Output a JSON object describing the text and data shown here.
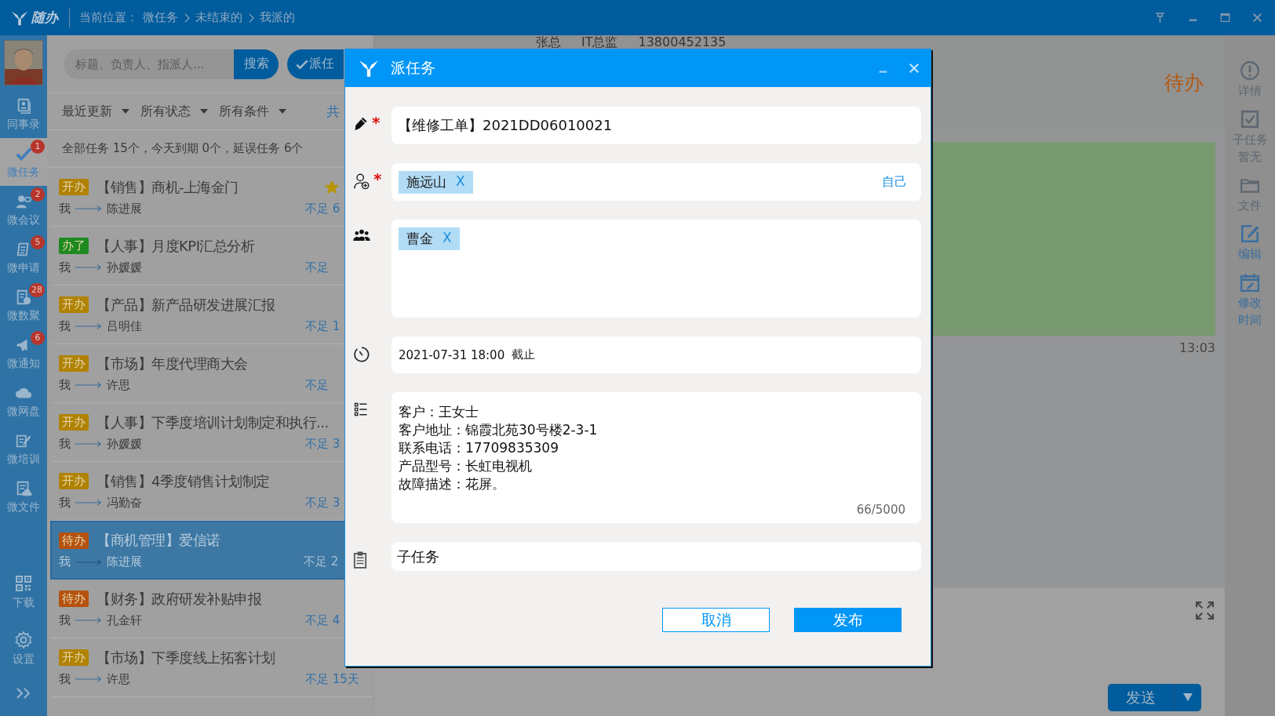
{
  "titlebar": {
    "logo_text": "随办",
    "location_label": "当前位置：",
    "breadcrumb": [
      "微任务",
      "未结束的",
      "我派的"
    ]
  },
  "sidebar": {
    "items": [
      {
        "label": "同事录",
        "selected": false
      },
      {
        "label": "微任务",
        "badge": "1",
        "selected": true
      },
      {
        "label": "微会议",
        "badge": "2",
        "selected": false
      },
      {
        "label": "微申请",
        "badge": "5",
        "selected": false
      },
      {
        "label": "微数聚",
        "badge": "28",
        "selected": false
      },
      {
        "label": "微通知",
        "badge": "6",
        "selected": false
      },
      {
        "label": "微网盘",
        "selected": false
      },
      {
        "label": "微培训",
        "selected": false
      },
      {
        "label": "微文件",
        "selected": false
      }
    ],
    "bottom_items": [
      {
        "label": "下载"
      },
      {
        "label": "设置"
      }
    ]
  },
  "list": {
    "search": {
      "placeholder": "标题、负责人、指派人...",
      "button": "搜索"
    },
    "assign_button": "派任",
    "filters": [
      {
        "label": "最近更新"
      },
      {
        "label": "所有状态"
      },
      {
        "label": "所有条件"
      }
    ],
    "filter_cut": "共",
    "summary": "全部任务 15个，今天到期 0个，延误任务 6个",
    "tasks": [
      {
        "status": "开办",
        "color": "#b08200",
        "title": "【销售】商机-上海金门",
        "from": "我",
        "to": "陈进展",
        "due": "不足 6",
        "starred": true,
        "selected": false
      },
      {
        "status": "办了",
        "color": "#1f8a1f",
        "title": "【人事】月度KPI汇总分析",
        "from": "我",
        "to": "孙媛媛",
        "due": "不足",
        "starred": false,
        "selected": false
      },
      {
        "status": "开办",
        "color": "#b08200",
        "title": "【产品】新产品研发进展汇报",
        "from": "我",
        "to": "吕明佳",
        "due": "不足 1",
        "starred": false,
        "selected": false
      },
      {
        "status": "开办",
        "color": "#b08200",
        "title": "【市场】年度代理商大会",
        "from": "我",
        "to": "许思",
        "due": "不足",
        "starred": false,
        "selected": false
      },
      {
        "status": "开办",
        "color": "#b08200",
        "title": "【人事】下季度培训计划制定和执行...",
        "from": "我",
        "to": "孙媛媛",
        "due": "不足 3",
        "starred": false,
        "selected": false
      },
      {
        "status": "开办",
        "color": "#b08200",
        "title": "【销售】4季度销售计划制定",
        "from": "我",
        "to": "冯勤奋",
        "due": "不足 3",
        "starred": false,
        "selected": false
      },
      {
        "status": "待办",
        "color": "#b5520e",
        "title": "【商机管理】爱信诺",
        "from": "我",
        "to": "陈进展",
        "due": "不足 2",
        "starred": false,
        "selected": true
      },
      {
        "status": "待办",
        "color": "#b5520e",
        "title": "【财务】政府研发补贴申报",
        "from": "我",
        "to": "孔金轩",
        "due": "不足 4",
        "starred": false,
        "selected": false
      },
      {
        "status": "开办",
        "color": "#b08200",
        "title": "【市场】下季度线上拓客计划",
        "from": "我",
        "to": "许思",
        "due": "不足 15天",
        "starred": false,
        "selected": false
      }
    ]
  },
  "detail": {
    "contact": [
      "张总",
      "IT总监",
      "13800452135"
    ],
    "status": "待办",
    "time": "13:03",
    "send_button": "发送"
  },
  "toolbar": [
    {
      "lines": [
        "详情"
      ],
      "disabled": true
    },
    {
      "lines": [
        "子任务",
        "暂无"
      ],
      "disabled": true
    },
    {
      "lines": [
        "文件"
      ],
      "disabled": true
    },
    {
      "lines": [
        "编辑"
      ],
      "disabled": false
    },
    {
      "lines": [
        "修改",
        "时间"
      ],
      "disabled": false
    }
  ],
  "dialog": {
    "title": "派任务",
    "title_field": {
      "value": "【维修工单】2021DD06010021",
      "required_mark": "*"
    },
    "assignee": {
      "required_mark": "*",
      "tags": [
        {
          "name": "施远山",
          "remove": "X"
        }
      ],
      "self_link": "自己"
    },
    "participants": {
      "tags": [
        {
          "name": "曹金",
          "remove": "X"
        }
      ]
    },
    "deadline": {
      "value": "2021-07-31 18:00",
      "suffix": "截止"
    },
    "description": {
      "lines": [
        "客户：王女士",
        "客户地址：锦霞北苑30号楼2-3-1",
        "联系电话：17709835309",
        "产品型号：长虹电视机",
        "故障描述：花屏。"
      ],
      "counter": "66/5000"
    },
    "subtask": {
      "label": "子任务"
    },
    "buttons": [
      {
        "label": "取消",
        "kind": "secondary"
      },
      {
        "label": "发布",
        "kind": "primary"
      }
    ]
  }
}
